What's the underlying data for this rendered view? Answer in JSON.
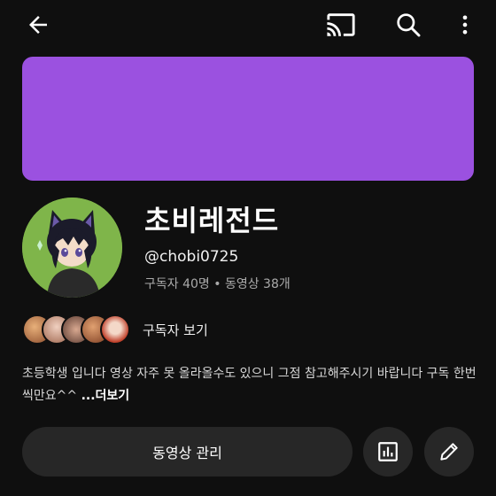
{
  "colors": {
    "background": "#0f0f0f",
    "banner": "#9b51e0",
    "avatar_bg": "#7fb54a",
    "button_bg": "#272727"
  },
  "topbar": {
    "icons": [
      "back-arrow-icon",
      "cast-icon",
      "search-icon",
      "more-vert-icon"
    ]
  },
  "channel": {
    "name": "초비레전드",
    "handle": "@chobi0725",
    "stats": "구독자 40명 • 동영상 38개"
  },
  "subscribers": {
    "label": "구독자 보기"
  },
  "description": {
    "text": "초등학생 입니다 영상 자주 못 올라올수도 있으니 그점 참고해주시기 바랍니다 구독 한번씩만요^^ ",
    "more": "...더보기"
  },
  "actions": {
    "manage_label": "동영상 관리",
    "stats_icon": "analytics-icon",
    "edit_icon": "pencil-icon"
  }
}
